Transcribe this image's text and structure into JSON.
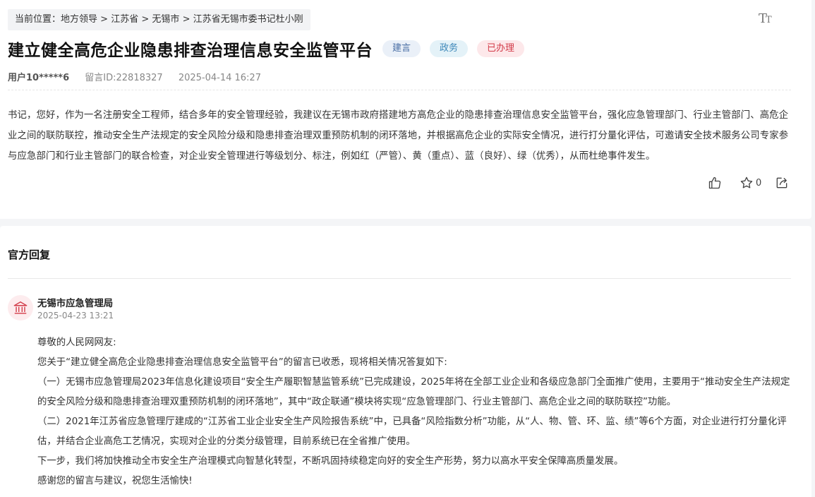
{
  "breadcrumb": {
    "prefix": "当前位置：",
    "items": [
      "地方领导",
      "江苏省",
      "无锡市",
      "江苏省无锡市委书记杜小刚"
    ],
    "separator": ">"
  },
  "font_toggle": {
    "big": "T",
    "small": "T"
  },
  "post": {
    "title": "建立健全高危企业隐患排查治理信息安全监管平台",
    "tags": [
      "建言",
      "政务",
      "已办理"
    ],
    "user": "用户10*****6",
    "message_id": "留言ID:22818327",
    "datetime": "2025-04-14 16:27",
    "content": "书记，您好，作为一名注册安全工程师，结合多年的安全管理经验，我建议在无锡市政府搭建地方高危企业的隐患排查治理信息安全监管平台，强化应急管理部门、行业主管部门、高危企业之间的联防联控，推动安全生产法规定的安全风险分级和隐患排查治理双重预防机制的闭环落地，并根据高危企业的实际安全情况，进行打分量化评估，可邀请安全技术服务公司专家参与应急部门和行业主管部门的联合检查，对企业安全管理进行等级划分、标注，例如红（严管）、黄（重点）、蓝（良好）、绿（优秀），从而杜绝事件发生。",
    "fav_count": "0"
  },
  "reply": {
    "heading": "官方回复",
    "org": "无锡市应急管理局",
    "datetime": "2025-04-23 13:21",
    "paragraphs": [
      "尊敬的人民网网友:",
      "您关于“建立健全高危企业隐患排查治理信息安全监管平台”的留言已收悉，现将相关情况答复如下:",
      "（一）无锡市应急管理局2023年信息化建设项目“安全生产履职智慧监管系统”已完成建设，2025年将在全部工业企业和各级应急部门全面推广使用，主要用于“推动安全生产法规定的安全风险分级和隐患排查治理双重预防机制的闭环落地”，其中“政企联通”模块将实现“应急管理部门、行业主管部门、高危企业之间的联防联控”功能。",
      "（二）2021年江苏省应急管理厅建成的“江苏省工业企业安全生产风险报告系统”中，已具备“风险指数分析”功能，从“人、物、管、环、监、绩”等6个方面，对企业进行打分量化评估，并结合企业高危工艺情况，实现对企业的分类分级管理，目前系统已在全省推广使用。",
      "下一步，我们将加快推动全市安全生产治理模式向智慧化转型，不断巩固持续稳定向好的安全生产形势，努力以高水平安全保障高质量发展。",
      "感谢您的留言与建议，祝您生活愉快!"
    ]
  },
  "colors": {
    "tag_jianyan": "#4a6fa5",
    "tag_zhengwu": "#3a86b8",
    "tag_done": "#d23a48",
    "org_icon": "#d23a48"
  },
  "icons": {
    "like": "thumbs-up-icon",
    "favorite": "star-icon",
    "share": "share-icon",
    "org": "government-building-icon"
  }
}
